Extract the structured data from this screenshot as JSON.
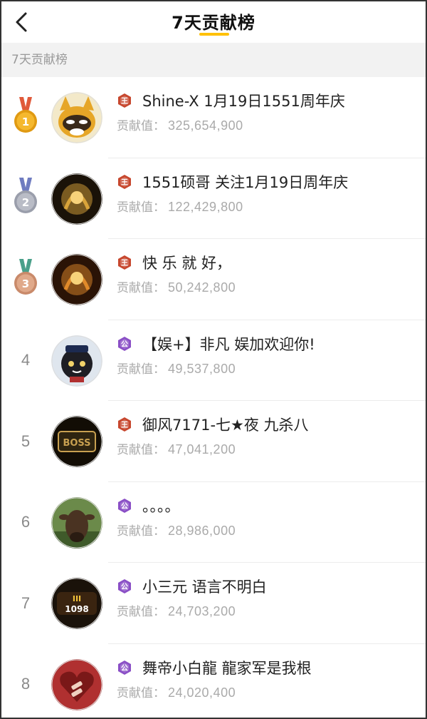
{
  "header": {
    "title": "7天贡献榜"
  },
  "section": {
    "label": "7天贡献榜"
  },
  "contrib_label": "贡献值：",
  "colors": {
    "accent": "#ffc107",
    "badge_red": "#c7472e",
    "badge_purple": "#8a4fc6"
  },
  "rows": [
    {
      "rank": "1",
      "medal": "gold-medal-icon",
      "badge": "king-badge",
      "badge_text": "王",
      "name": "Shine-X 1月19日1551周年庆",
      "value": "325,654,900"
    },
    {
      "rank": "2",
      "medal": "silver-medal-icon",
      "badge": "king-badge",
      "badge_text": "王",
      "name": "1551硕哥 关注1月19日周年庆",
      "value": "122,429,800"
    },
    {
      "rank": "3",
      "medal": "bronze-medal-icon",
      "badge": "king-badge",
      "badge_text": "王",
      "name": "快 乐 就 好，",
      "value": "50,242,800"
    },
    {
      "rank": "4",
      "badge": "duke-badge",
      "badge_text": "公",
      "name": "【娱+】非凡 娱加欢迎你!",
      "value": "49,537,800"
    },
    {
      "rank": "5",
      "badge": "king-badge",
      "badge_text": "王",
      "name": "御风7171-七★夜 九杀八",
      "value": "47,041,200"
    },
    {
      "rank": "6",
      "badge": "duke-badge",
      "badge_text": "公",
      "name": "。。。。",
      "value": "28,986,000"
    },
    {
      "rank": "7",
      "badge": "duke-badge",
      "badge_text": "公",
      "name": "小三元  语言不明白",
      "value": "24,703,200"
    },
    {
      "rank": "8",
      "badge": "duke-badge",
      "badge_text": "公",
      "name": "舞帝小白龍  龍家军是我根",
      "value": "24,020,400"
    }
  ]
}
